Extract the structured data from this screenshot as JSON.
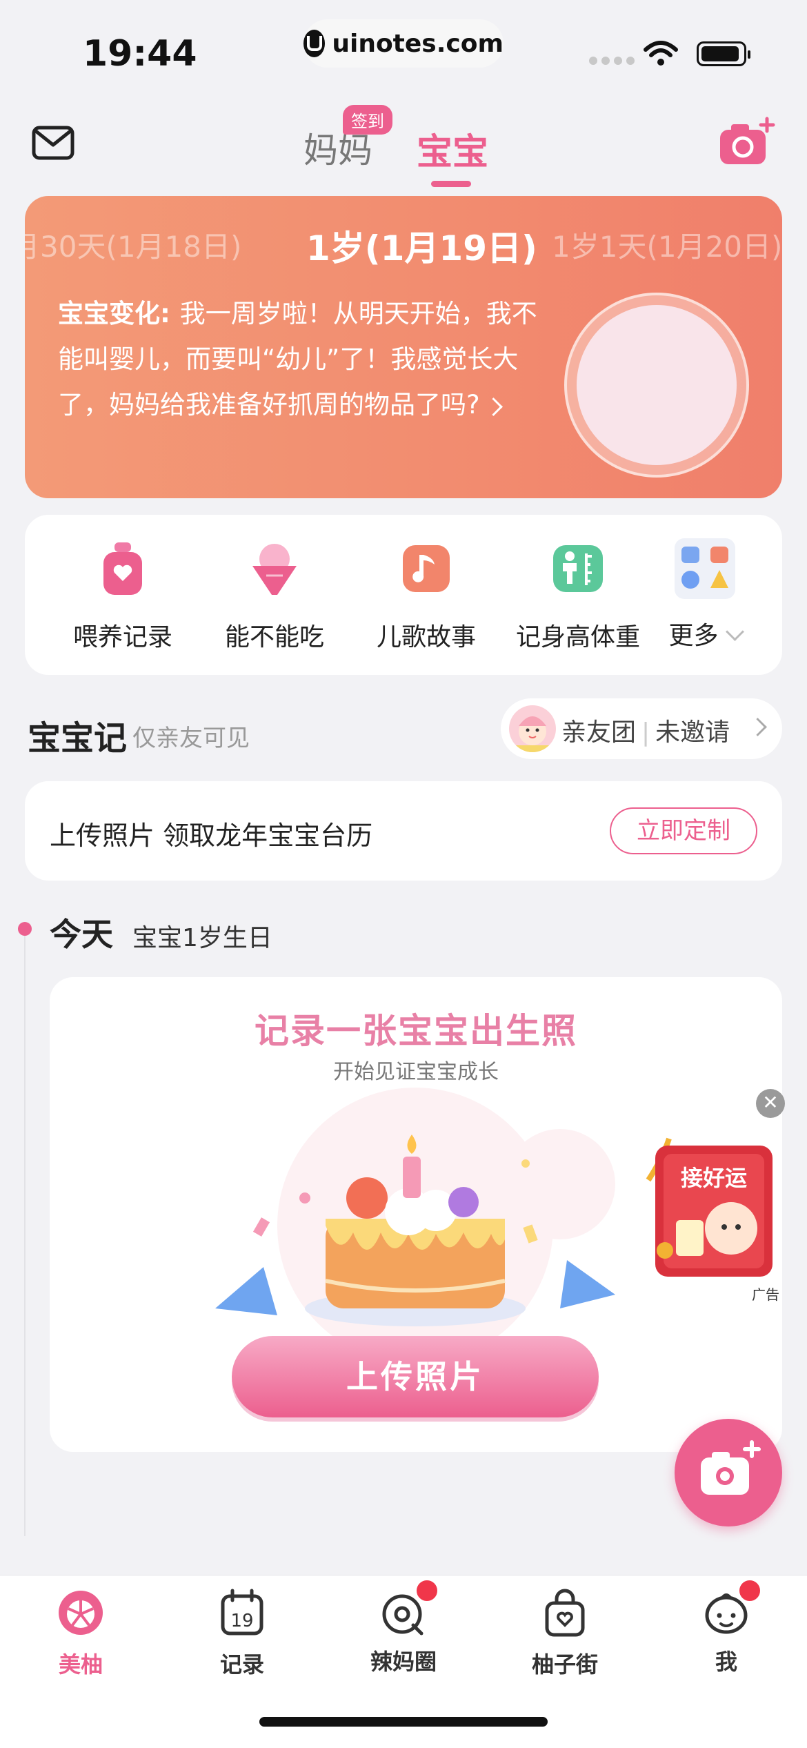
{
  "status_bar": {
    "time": "19:44",
    "url": "uinotes.com"
  },
  "header": {
    "tab_mama": "妈妈",
    "checkin_badge": "签到",
    "tab_baobao": "宝宝"
  },
  "hero": {
    "date_prev": "月30天(1月18日)",
    "date_current": "1岁(1月19日)",
    "date_next": "1岁1天(1月20日)",
    "change_label": "宝宝变化:",
    "change_text": "我一周岁啦！从明天开始，我不能叫婴儿，而要叫“幼儿”了！我感觉长大了，妈妈给我准备好抓周的物品了吗?"
  },
  "tools": [
    {
      "label": "喂养记录",
      "icon": "bottle-icon"
    },
    {
      "label": "能不能吃",
      "icon": "ice-cream-icon"
    },
    {
      "label": "儿歌故事",
      "icon": "music-note-icon"
    },
    {
      "label": "记身高体重",
      "icon": "height-ruler-icon"
    },
    {
      "label": "更多",
      "icon": "more-apps-icon"
    }
  ],
  "baby_record": {
    "title": "宝宝记",
    "subtitle": "仅亲友可见",
    "friends_group": "亲友团",
    "not_invited": "未邀请"
  },
  "banner": {
    "text": "上传照片 领取龙年宝宝台历",
    "button": "立即定制"
  },
  "timeline": {
    "today": "今天",
    "today_sub": "宝宝1岁生日"
  },
  "birth_card": {
    "title": "记录一张宝宝出生照",
    "subtitle": "开始见证宝宝成长",
    "button": "上传照片"
  },
  "ad": {
    "label": "广告",
    "charm_text": "接好运"
  },
  "bottom_nav": [
    {
      "label": "美柚",
      "icon": "meiyou-icon",
      "active": true
    },
    {
      "label": "记录",
      "icon": "calendar-icon",
      "active": false
    },
    {
      "label": "辣妈圈",
      "icon": "community-icon",
      "active": false
    },
    {
      "label": "柚子街",
      "icon": "shopping-bag-icon",
      "active": false
    },
    {
      "label": "我",
      "icon": "profile-face-icon",
      "active": false
    }
  ],
  "colors": {
    "accent": "#ec5f8e",
    "hero_start": "#f39a77",
    "hero_end": "#f07f6b"
  }
}
